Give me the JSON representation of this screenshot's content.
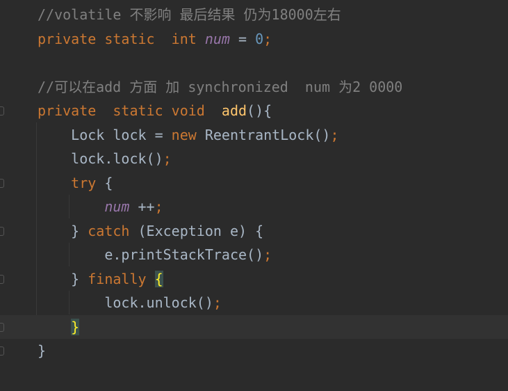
{
  "colors": {
    "background": "#2b2b2b",
    "current_line": "#323232",
    "keyword": "#cc7832",
    "comment": "#808080",
    "field": "#9876aa",
    "number": "#6897bb",
    "method": "#ffc66d",
    "identifier": "#a9b7c6",
    "brace_match": "#ffef28"
  },
  "lines": [
    {
      "fold": false,
      "tokens": [
        [
          "//volatile 不影响 最后结果 仍为18000左右",
          "cm"
        ]
      ]
    },
    {
      "fold": false,
      "tokens": [
        [
          "private static  int ",
          "kw"
        ],
        [
          "num",
          "fld"
        ],
        [
          " = ",
          "id"
        ],
        [
          "0",
          "num"
        ],
        [
          ";",
          "kw"
        ]
      ]
    },
    {
      "fold": false,
      "tokens": []
    },
    {
      "fold": false,
      "tokens": [
        [
          "//可以在add 方面 加 synchronized  num 为2 0000",
          "cm"
        ]
      ]
    },
    {
      "fold": true,
      "tokens": [
        [
          "private  static void  ",
          "kw"
        ],
        [
          "add",
          "fn"
        ],
        [
          "(){",
          "id"
        ]
      ]
    },
    {
      "fold": false,
      "tokens": [
        [
          "    Lock lock = ",
          "id"
        ],
        [
          "new ",
          "kw"
        ],
        [
          "ReentrantLock()",
          "id"
        ],
        [
          ";",
          "kw"
        ]
      ]
    },
    {
      "fold": false,
      "tokens": [
        [
          "    lock.lock()",
          "id"
        ],
        [
          ";",
          "kw"
        ]
      ]
    },
    {
      "fold": true,
      "tokens": [
        [
          "    ",
          "id"
        ],
        [
          "try ",
          "kw"
        ],
        [
          "{",
          "id"
        ]
      ]
    },
    {
      "fold": false,
      "tokens": [
        [
          "        ",
          "id"
        ],
        [
          "num",
          "fld"
        ],
        [
          " ++",
          "id"
        ],
        [
          ";",
          "kw"
        ]
      ]
    },
    {
      "fold": true,
      "tokens": [
        [
          "    } ",
          "id"
        ],
        [
          "catch ",
          "kw"
        ],
        [
          "(Exception e) {",
          "id"
        ]
      ]
    },
    {
      "fold": false,
      "tokens": [
        [
          "        e.printStackTrace()",
          "id"
        ],
        [
          ";",
          "kw"
        ]
      ]
    },
    {
      "fold": true,
      "tokens": [
        [
          "    } ",
          "id"
        ],
        [
          "finally ",
          "kw"
        ],
        [
          "{",
          "br"
        ]
      ]
    },
    {
      "fold": false,
      "tokens": [
        [
          "        lock.unlock()",
          "id"
        ],
        [
          ";",
          "kw"
        ]
      ]
    },
    {
      "fold": true,
      "current": true,
      "tokens": [
        [
          "    ",
          "id"
        ],
        [
          "}",
          "br"
        ]
      ]
    },
    {
      "fold": true,
      "tokens": [
        [
          "}",
          "id"
        ]
      ]
    }
  ]
}
